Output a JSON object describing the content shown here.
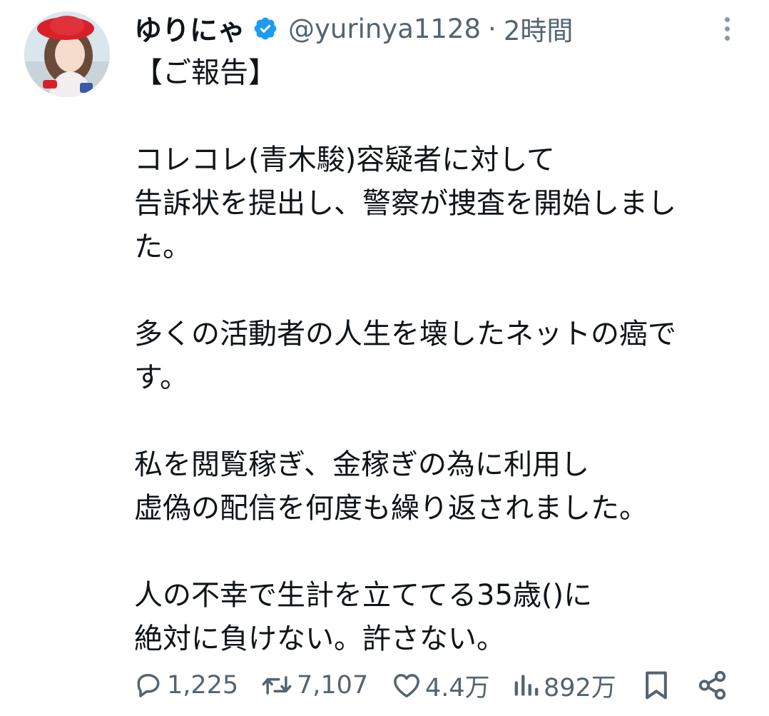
{
  "colors": {
    "text": "#0f1419",
    "secondary": "#536471",
    "verified": "#1d9bf0",
    "background": "#ffffff"
  },
  "author": {
    "name": "ゆりにゃ",
    "verified_icon": "verified-badge-icon",
    "handle": "@yurinya1128",
    "separator": "·",
    "time": "2時間"
  },
  "menu": {
    "icon": "more-vertical-icon"
  },
  "post": {
    "lines": [
      "【ご報告】",
      "",
      "コレコレ(青木駿)容疑者に対して",
      "告訴状を提出し、警察が捜査を開始しまし",
      "た。",
      "",
      "多くの活動者の人生を壊したネットの癌で",
      "す。",
      "",
      "私を閲覧稼ぎ、金稼ぎの為に利用し",
      "虚偽の配信を何度も繰り返されました。",
      "",
      "人の不幸で生計を立ててる35歳()に",
      "絶対に負けない。許さない。"
    ]
  },
  "actions": {
    "reply": {
      "icon": "reply-icon",
      "count": "1,225"
    },
    "retweet": {
      "icon": "retweet-icon",
      "count": "7,107"
    },
    "like": {
      "icon": "heart-icon",
      "count": "4.4万"
    },
    "views": {
      "icon": "views-chart-icon",
      "count": "892万"
    },
    "bookmark": {
      "icon": "bookmark-icon"
    },
    "share": {
      "icon": "share-icon"
    }
  }
}
